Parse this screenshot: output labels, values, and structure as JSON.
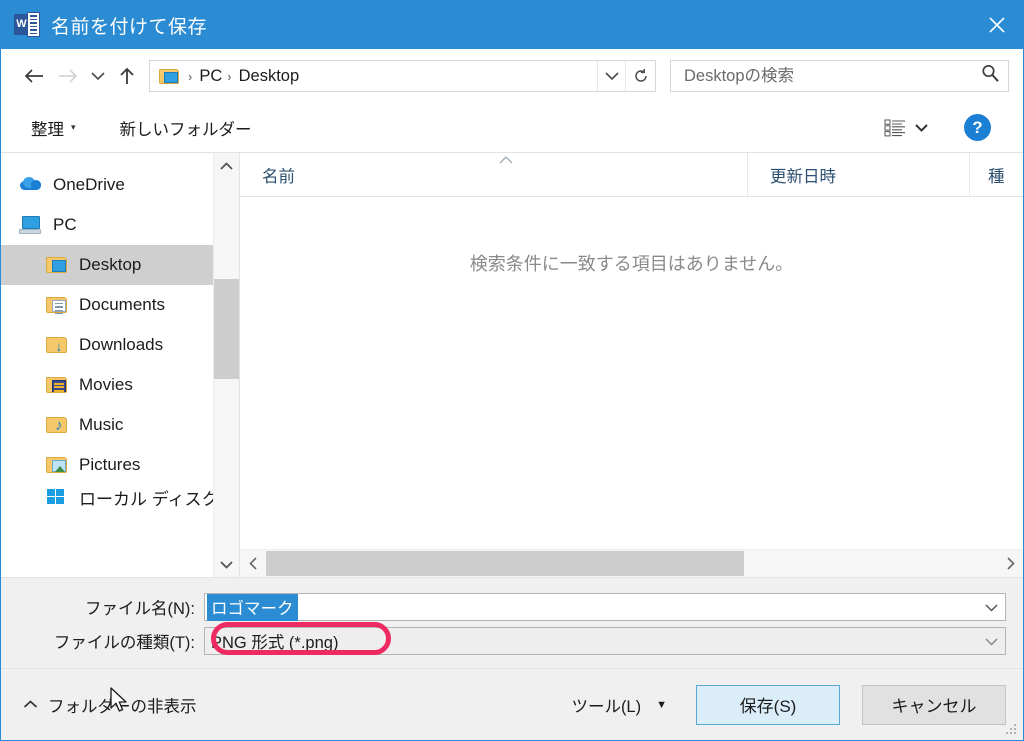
{
  "window": {
    "title": "名前を付けて保存",
    "app_icon": "word-icon",
    "close_label": "×"
  },
  "nav": {
    "back_icon": "back-arrow-icon",
    "forward_icon": "forward-arrow-icon",
    "recent_icon": "recent-locations-chevron-icon",
    "up_icon": "up-arrow-icon",
    "breadcrumb": {
      "folder_icon": "desktop-folder-icon",
      "crumbs": [
        "PC",
        "Desktop"
      ],
      "separator": "›",
      "dropdown_icon": "chevron-down-icon",
      "refresh_icon": "refresh-icon"
    },
    "search": {
      "placeholder": "Desktopの検索",
      "value": "",
      "icon": "search-icon"
    }
  },
  "toolbar": {
    "organize_label": "整理",
    "organize_caret": "▾",
    "new_folder_label": "新しいフォルダー",
    "view_icon": "list-view-icon",
    "view_caret_icon": "chevron-down-icon",
    "help_label": "?",
    "help_icon": "help-icon"
  },
  "sidebar": {
    "items": [
      {
        "label": "OneDrive",
        "icon": "onedrive-cloud-icon",
        "level": 0,
        "selected": false
      },
      {
        "label": "PC",
        "icon": "pc-monitor-icon",
        "level": 0,
        "selected": false
      },
      {
        "label": "Desktop",
        "icon": "desktop-folder-icon",
        "level": 1,
        "selected": true
      },
      {
        "label": "Documents",
        "icon": "documents-folder-icon",
        "level": 1,
        "selected": false
      },
      {
        "label": "Downloads",
        "icon": "downloads-folder-icon",
        "level": 1,
        "selected": false
      },
      {
        "label": "Movies",
        "icon": "movies-folder-icon",
        "level": 1,
        "selected": false
      },
      {
        "label": "Music",
        "icon": "music-folder-icon",
        "level": 1,
        "selected": false
      },
      {
        "label": "Pictures",
        "icon": "pictures-folder-icon",
        "level": 1,
        "selected": false
      },
      {
        "label": "ローカル ディスク (C:",
        "icon": "windows-logo-icon",
        "level": 1,
        "selected": false
      }
    ],
    "scrollbar": {
      "up_icon": "chevron-up-icon",
      "down_icon": "chevron-down-icon"
    }
  },
  "filelist": {
    "columns": [
      {
        "label": "名前",
        "sorted": true,
        "sort_icon": "sort-ascending-icon"
      },
      {
        "label": "更新日時",
        "sorted": false
      },
      {
        "label": "種",
        "sorted": false
      }
    ],
    "empty_message": "検索条件に一致する項目はありません。",
    "hscrollbar": {
      "left_icon": "chevron-left-icon",
      "right_icon": "chevron-right-icon"
    }
  },
  "form": {
    "filename": {
      "label": "ファイル名(N):",
      "value": "ロゴマーク",
      "selected": true,
      "dropdown_icon": "chevron-down-icon"
    },
    "filetype": {
      "label": "ファイルの種類(T):",
      "value": "PNG 形式 (*.png)",
      "dropdown_icon": "chevron-down-icon",
      "annotation_color": "#ee2a62"
    }
  },
  "footer": {
    "hide_folders_label": "フォルダーの非表示",
    "hide_folders_caret": "⌃",
    "tools_label": "ツール(L)",
    "tools_caret": "▼",
    "save_label": "保存(S)",
    "cancel_label": "キャンセル",
    "cursor_icon": "mouse-pointer-icon",
    "resize_grip_icon": "resize-grip-icon"
  },
  "colors": {
    "titlebar": "#2b8cd3",
    "accent": "#1b7fd4",
    "annotation": "#ee2a62",
    "selection": "#2b8cd3"
  }
}
